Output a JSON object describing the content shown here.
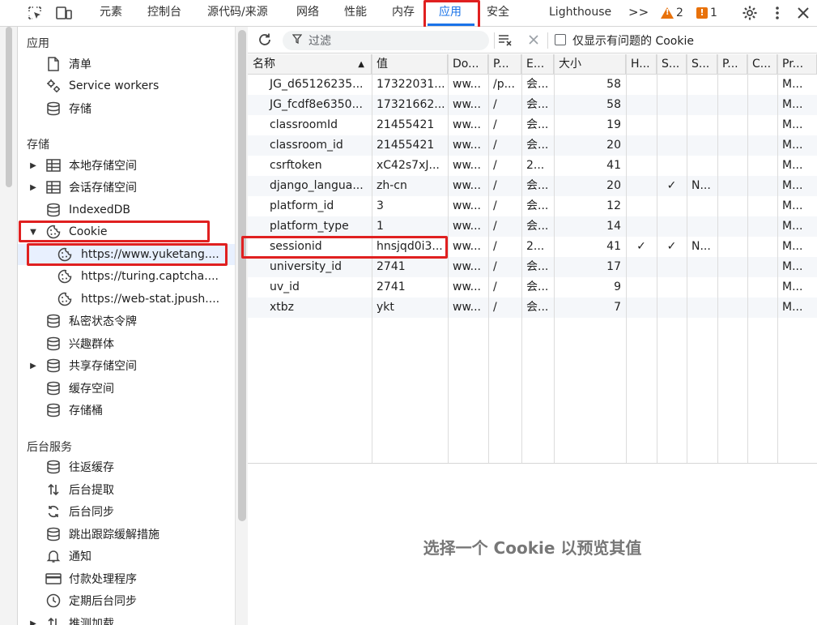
{
  "toolbar": {
    "tabs": [
      {
        "label": "元素"
      },
      {
        "label": "控制台"
      },
      {
        "label": "源代码/来源"
      },
      {
        "label": "网络"
      },
      {
        "label": "性能"
      },
      {
        "label": "内存"
      },
      {
        "label": "应用"
      },
      {
        "label": "安全"
      },
      {
        "label": "Lighthouse"
      }
    ],
    "more": ">>",
    "warnings_count": "2",
    "issues_count": "1",
    "accent": "#1a73e8"
  },
  "sidebar": {
    "sections": {
      "application": "应用",
      "storage": "存储",
      "background": "后台服务"
    },
    "application_items": [
      {
        "label": "清单",
        "icon": "document-icon"
      },
      {
        "label": "Service workers",
        "icon": "gears-icon"
      },
      {
        "label": "存储",
        "icon": "database-icon"
      }
    ],
    "storage_items": [
      {
        "label": "本地存储空间",
        "icon": "table-icon"
      },
      {
        "label": "会话存储空间",
        "icon": "table-icon"
      },
      {
        "label": "IndexedDB",
        "icon": "database-icon"
      },
      {
        "label": "Cookie",
        "icon": "cookie-icon"
      },
      {
        "label": "https://www.yuketang....",
        "icon": "cookie-icon"
      },
      {
        "label": "https://turing.captcha....",
        "icon": "cookie-icon"
      },
      {
        "label": "https://web-stat.jpush....",
        "icon": "cookie-icon"
      },
      {
        "label": "私密状态令牌",
        "icon": "database-icon"
      },
      {
        "label": "兴趣群体",
        "icon": "database-icon"
      },
      {
        "label": "共享存储空间",
        "icon": "database-icon"
      },
      {
        "label": "缓存空间",
        "icon": "database-icon"
      },
      {
        "label": "存储桶",
        "icon": "database-icon"
      }
    ],
    "background_items": [
      {
        "label": "往返缓存",
        "icon": "database-icon"
      },
      {
        "label": "后台提取",
        "icon": "arrows-icon"
      },
      {
        "label": "后台同步",
        "icon": "sync-icon"
      },
      {
        "label": "跳出跟踪缓解措施",
        "icon": "database-icon"
      },
      {
        "label": "通知",
        "icon": "bell-icon"
      },
      {
        "label": "付款处理程序",
        "icon": "card-icon"
      },
      {
        "label": "定期后台同步",
        "icon": "clock-icon"
      },
      {
        "label": "推测加载",
        "icon": "arrows-icon"
      }
    ]
  },
  "filter": {
    "placeholder": "过滤",
    "only_issues_label": "仅显示有问题的 Cookie"
  },
  "table": {
    "columns": [
      "名称",
      "值",
      "Do...",
      "P...",
      "E...",
      "大小",
      "H...",
      "S...",
      "S...",
      "P...",
      "C...",
      "Pr..."
    ],
    "rows": [
      [
        "JG_d65126235...",
        "17322031...",
        "ww...",
        "/p...",
        "会...",
        "58",
        "",
        "",
        "",
        "",
        "",
        "M..."
      ],
      [
        "JG_fcdf8e6350...",
        "17321662...",
        "ww...",
        "/",
        "会...",
        "58",
        "",
        "",
        "",
        "",
        "",
        "M..."
      ],
      [
        "classroomId",
        "21455421",
        "ww...",
        "/",
        "会...",
        "19",
        "",
        "",
        "",
        "",
        "",
        "M..."
      ],
      [
        "classroom_id",
        "21455421",
        "ww...",
        "/",
        "会...",
        "20",
        "",
        "",
        "",
        "",
        "",
        "M..."
      ],
      [
        "csrftoken",
        "xC42s7xJ...",
        "ww...",
        "/",
        "2...",
        "41",
        "",
        "",
        "",
        "",
        "",
        "M..."
      ],
      [
        "django_langua...",
        "zh-cn",
        "ww...",
        "/",
        "会...",
        "20",
        "",
        "✓",
        "N...",
        "",
        "",
        "M..."
      ],
      [
        "platform_id",
        "3",
        "ww...",
        "/",
        "会...",
        "12",
        "",
        "",
        "",
        "",
        "",
        "M..."
      ],
      [
        "platform_type",
        "1",
        "ww...",
        "/",
        "会...",
        "14",
        "",
        "",
        "",
        "",
        "",
        "M..."
      ],
      [
        "sessionid",
        "hnsjqd0i3...",
        "ww...",
        "/",
        "2...",
        "41",
        "✓",
        "✓",
        "N...",
        "",
        "",
        "M..."
      ],
      [
        "university_id",
        "2741",
        "ww...",
        "/",
        "会...",
        "17",
        "",
        "",
        "",
        "",
        "",
        "M..."
      ],
      [
        "uv_id",
        "2741",
        "ww...",
        "/",
        "会...",
        "9",
        "",
        "",
        "",
        "",
        "",
        "M..."
      ],
      [
        "xtbz",
        "ykt",
        "ww...",
        "/",
        "会...",
        "7",
        "",
        "",
        "",
        "",
        "",
        "M..."
      ]
    ]
  },
  "preview": {
    "empty_text": "选择一个 Cookie 以预览其值"
  },
  "highlight_color": "#e02020"
}
